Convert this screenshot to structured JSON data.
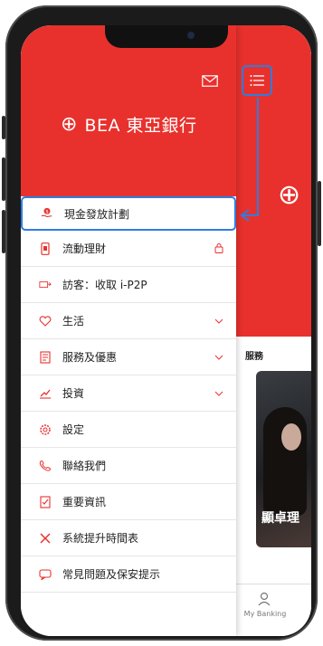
{
  "brand": {
    "name": "BEA 東亞銀行"
  },
  "main": {
    "services_label": "服務",
    "promo_text": "顯卓理",
    "tab_my_banking": "My Banking"
  },
  "menu": {
    "items": [
      {
        "label": "現金發放計劃",
        "icon": "cash-hand-icon"
      },
      {
        "label": "流動理財",
        "icon": "phone-icon",
        "trail": "lock-icon"
      },
      {
        "label": "訪客：收取 i-P2P",
        "icon": "money-transfer-icon"
      },
      {
        "label": "生活",
        "icon": "heart-icon",
        "trail": "chevron-down-icon"
      },
      {
        "label": "服務及優惠",
        "icon": "document-icon",
        "trail": "chevron-down-icon"
      },
      {
        "label": "投資",
        "icon": "chart-icon",
        "trail": "chevron-down-icon"
      },
      {
        "label": "設定",
        "icon": "gear-icon"
      },
      {
        "label": "聯絡我們",
        "icon": "phone-handset-icon"
      },
      {
        "label": "重要資訊",
        "icon": "checklist-icon"
      },
      {
        "label": "系統提升時間表",
        "icon": "tools-icon"
      },
      {
        "label": "常見問題及保安提示",
        "icon": "chat-icon"
      }
    ]
  },
  "colors": {
    "brand_red": "#e8312d",
    "highlight_blue": "#2e7de0",
    "icon_red": "#e8312d"
  }
}
